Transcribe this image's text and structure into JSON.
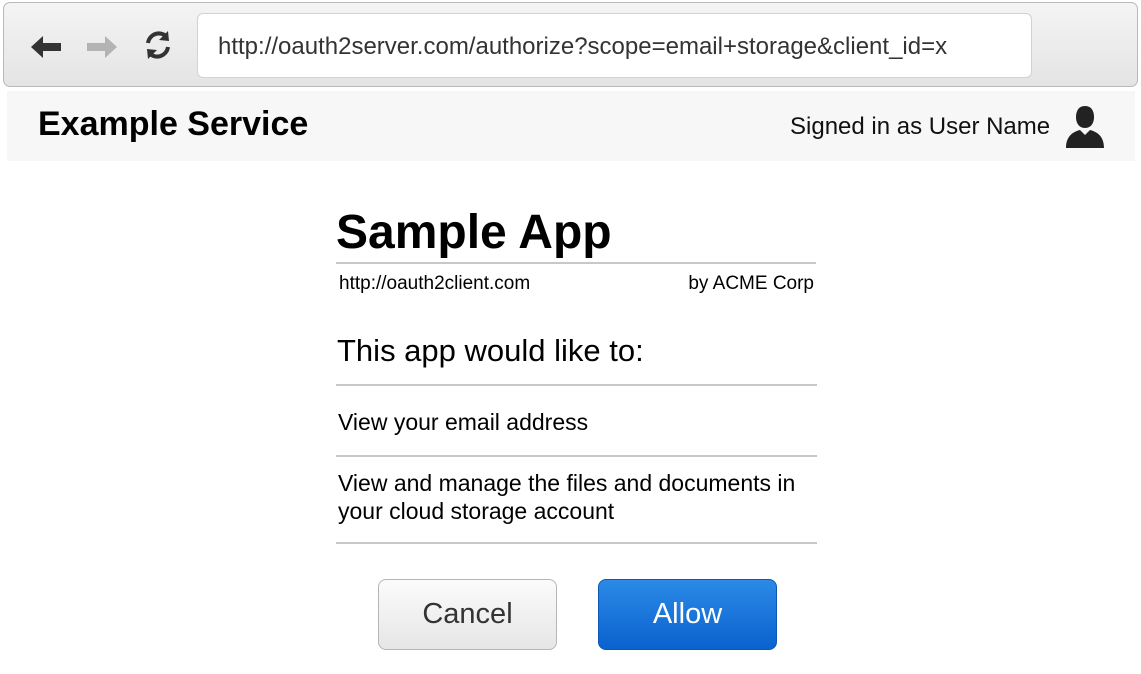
{
  "browser": {
    "url": "http://oauth2server.com/authorize?scope=email+storage&client_id=x",
    "icons": {
      "back": "arrow-left-icon",
      "forward": "arrow-right-icon",
      "reload": "reload-icon"
    }
  },
  "header": {
    "service_name": "Example Service",
    "signed_in_text": "Signed in as User Name",
    "avatar_icon": "user-silhouette-icon"
  },
  "consent": {
    "app_name": "Sample App",
    "app_url": "http://oauth2client.com",
    "app_vendor": "by ACME Corp",
    "heading": "This app would like to:",
    "permissions": [
      "View your email address",
      "View and manage the files and documents in your cloud storage account"
    ],
    "cancel_label": "Cancel",
    "allow_label": "Allow"
  },
  "colors": {
    "allow_button": "#0a62cf",
    "cancel_button": "#e6e6e6",
    "header_background": "#f7f7f7"
  }
}
